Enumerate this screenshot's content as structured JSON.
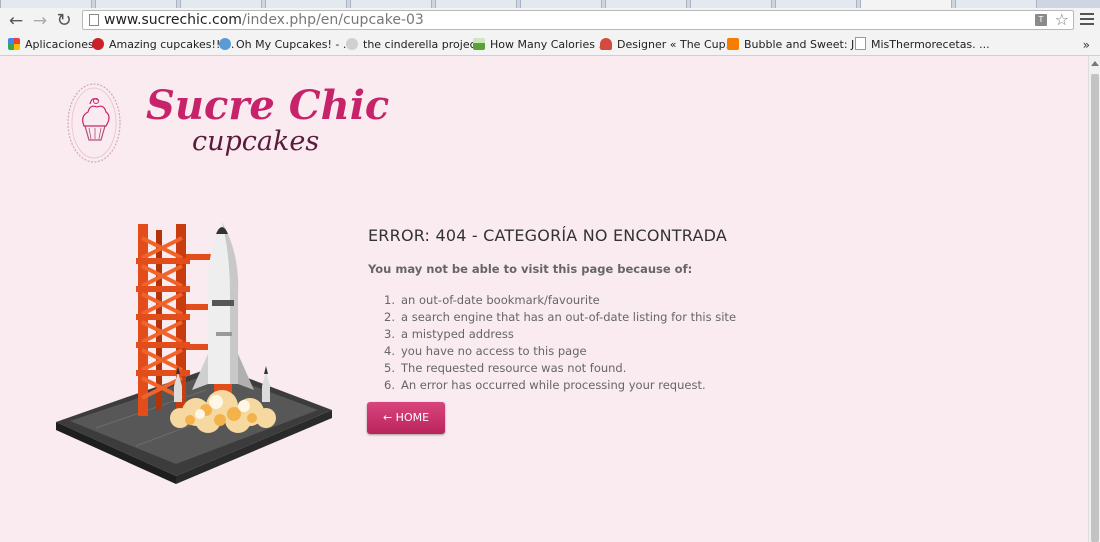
{
  "browser": {
    "url_host": "www.sucrechic.com",
    "url_path": "/index.php/en/cupcake-03"
  },
  "bookmarks": [
    {
      "label": "Aplicaciones",
      "icon": "apps-grid-icon",
      "color": "#4285f4"
    },
    {
      "label": "Amazing cupcakes!! ...",
      "icon": "pinterest-icon",
      "color": "#cb2027"
    },
    {
      "label": "Oh My Cupcakes! - ...",
      "icon": "blog-globe-icon",
      "color": "#5b9bd5"
    },
    {
      "label": "the cinderella projec...",
      "icon": "heart-icon",
      "color": "#bbbbbb"
    },
    {
      "label": "How Many Calories ...",
      "icon": "landscape-icon",
      "color": "#5aa03c"
    },
    {
      "label": "Designer « The Cup...",
      "icon": "cupcake-icon",
      "color": "#d24b3e"
    },
    {
      "label": "Bubble and Sweet: J...",
      "icon": "blogger-icon",
      "color": "#f57d00"
    },
    {
      "label": "MisThermorecetas. ...",
      "icon": "page-icon",
      "color": "#999999"
    }
  ],
  "bookmarks_overflow": "»",
  "logo": {
    "title": "Sucre Chic",
    "subtitle": "cupcakes",
    "brand_color": "#c7236a"
  },
  "error": {
    "title": "ERROR: 404 - CATEGORÍA NO ENCONTRADA",
    "lead": "You may not be able to visit this page because of:",
    "reasons": [
      {
        "num": "1.",
        "text": "an out-of-date bookmark/favourite"
      },
      {
        "num": "2.",
        "text": "a search engine that has an out-of-date listing for this site"
      },
      {
        "num": "3.",
        "text": "a mistyped address"
      },
      {
        "num": "4.",
        "text": "you have no access to this page"
      },
      {
        "num": "5.",
        "text": "The requested resource was not found."
      },
      {
        "num": "6.",
        "text": "An error has occurred while processing your request."
      }
    ],
    "home_label": "← HOME"
  }
}
